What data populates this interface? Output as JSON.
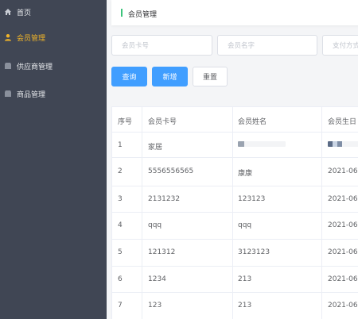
{
  "sidebar": {
    "items": [
      {
        "label": "首页",
        "icon": "home-icon",
        "active": false
      },
      {
        "label": "会员管理",
        "icon": "user-icon",
        "active": true
      },
      {
        "label": "供应商管理",
        "icon": "store-icon",
        "active": false
      },
      {
        "label": "商品管理",
        "icon": "store-icon",
        "active": false
      }
    ]
  },
  "breadcrumb": {
    "title": "会员管理"
  },
  "search": {
    "card_placeholder": "会员卡号",
    "name_placeholder": "会员名字",
    "payment_placeholder": "支付方式"
  },
  "actions": {
    "query_label": "查询",
    "add_label": "新增",
    "reset_label": "重置"
  },
  "table": {
    "headers": [
      "序号",
      "会员卡号",
      "会员姓名",
      "会员生日"
    ],
    "rows": [
      {
        "index": "1",
        "card": "家居",
        "name": "",
        "birthday": ""
      },
      {
        "index": "2",
        "card": "5556556565",
        "name": "康康",
        "birthday": "2021-06-"
      },
      {
        "index": "3",
        "card": "2131232",
        "name": "123123",
        "birthday": "2021-06-"
      },
      {
        "index": "4",
        "card": "qqq",
        "name": "qqq",
        "birthday": "2021-06-"
      },
      {
        "index": "5",
        "card": "121312",
        "name": "3123123",
        "birthday": "2021-06-"
      },
      {
        "index": "6",
        "card": "1234",
        "name": "213",
        "birthday": "2021-06-"
      },
      {
        "index": "7",
        "card": "123",
        "name": "213",
        "birthday": "2021-06-"
      }
    ]
  },
  "colors": {
    "sidebar_bg": "#404654",
    "active_text": "#f0b429",
    "primary": "#409eff",
    "accent_mark": "#3cc47c"
  }
}
